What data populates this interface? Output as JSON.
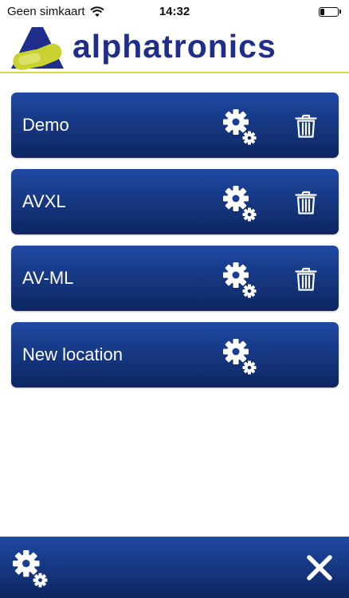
{
  "status_bar": {
    "carrier": "Geen simkaart",
    "time": "14:32",
    "battery_level": 0.25,
    "wifi_icon": "wifi-icon",
    "battery_icon": "battery-icon"
  },
  "header": {
    "brand": "alphatronics",
    "logo_icon": "alphatronics-logo-icon",
    "brand_color": "#1f2e8a",
    "accent_color": "#c9d22e"
  },
  "locations": [
    {
      "label": "Demo",
      "settings_icon": "gear-icon",
      "delete_icon": "trash-icon"
    },
    {
      "label": "AVXL",
      "settings_icon": "gear-icon",
      "delete_icon": "trash-icon"
    },
    {
      "label": "AV-ML",
      "settings_icon": "gear-icon",
      "delete_icon": "trash-icon"
    },
    {
      "label": "New location",
      "settings_icon": "gear-icon"
    }
  ],
  "bottom_bar": {
    "settings_icon": "gear-icon",
    "close_icon": "close-icon"
  },
  "colors": {
    "button_top": "#1f49a3",
    "button_bottom": "#0d2660",
    "text": "#ffffff"
  }
}
